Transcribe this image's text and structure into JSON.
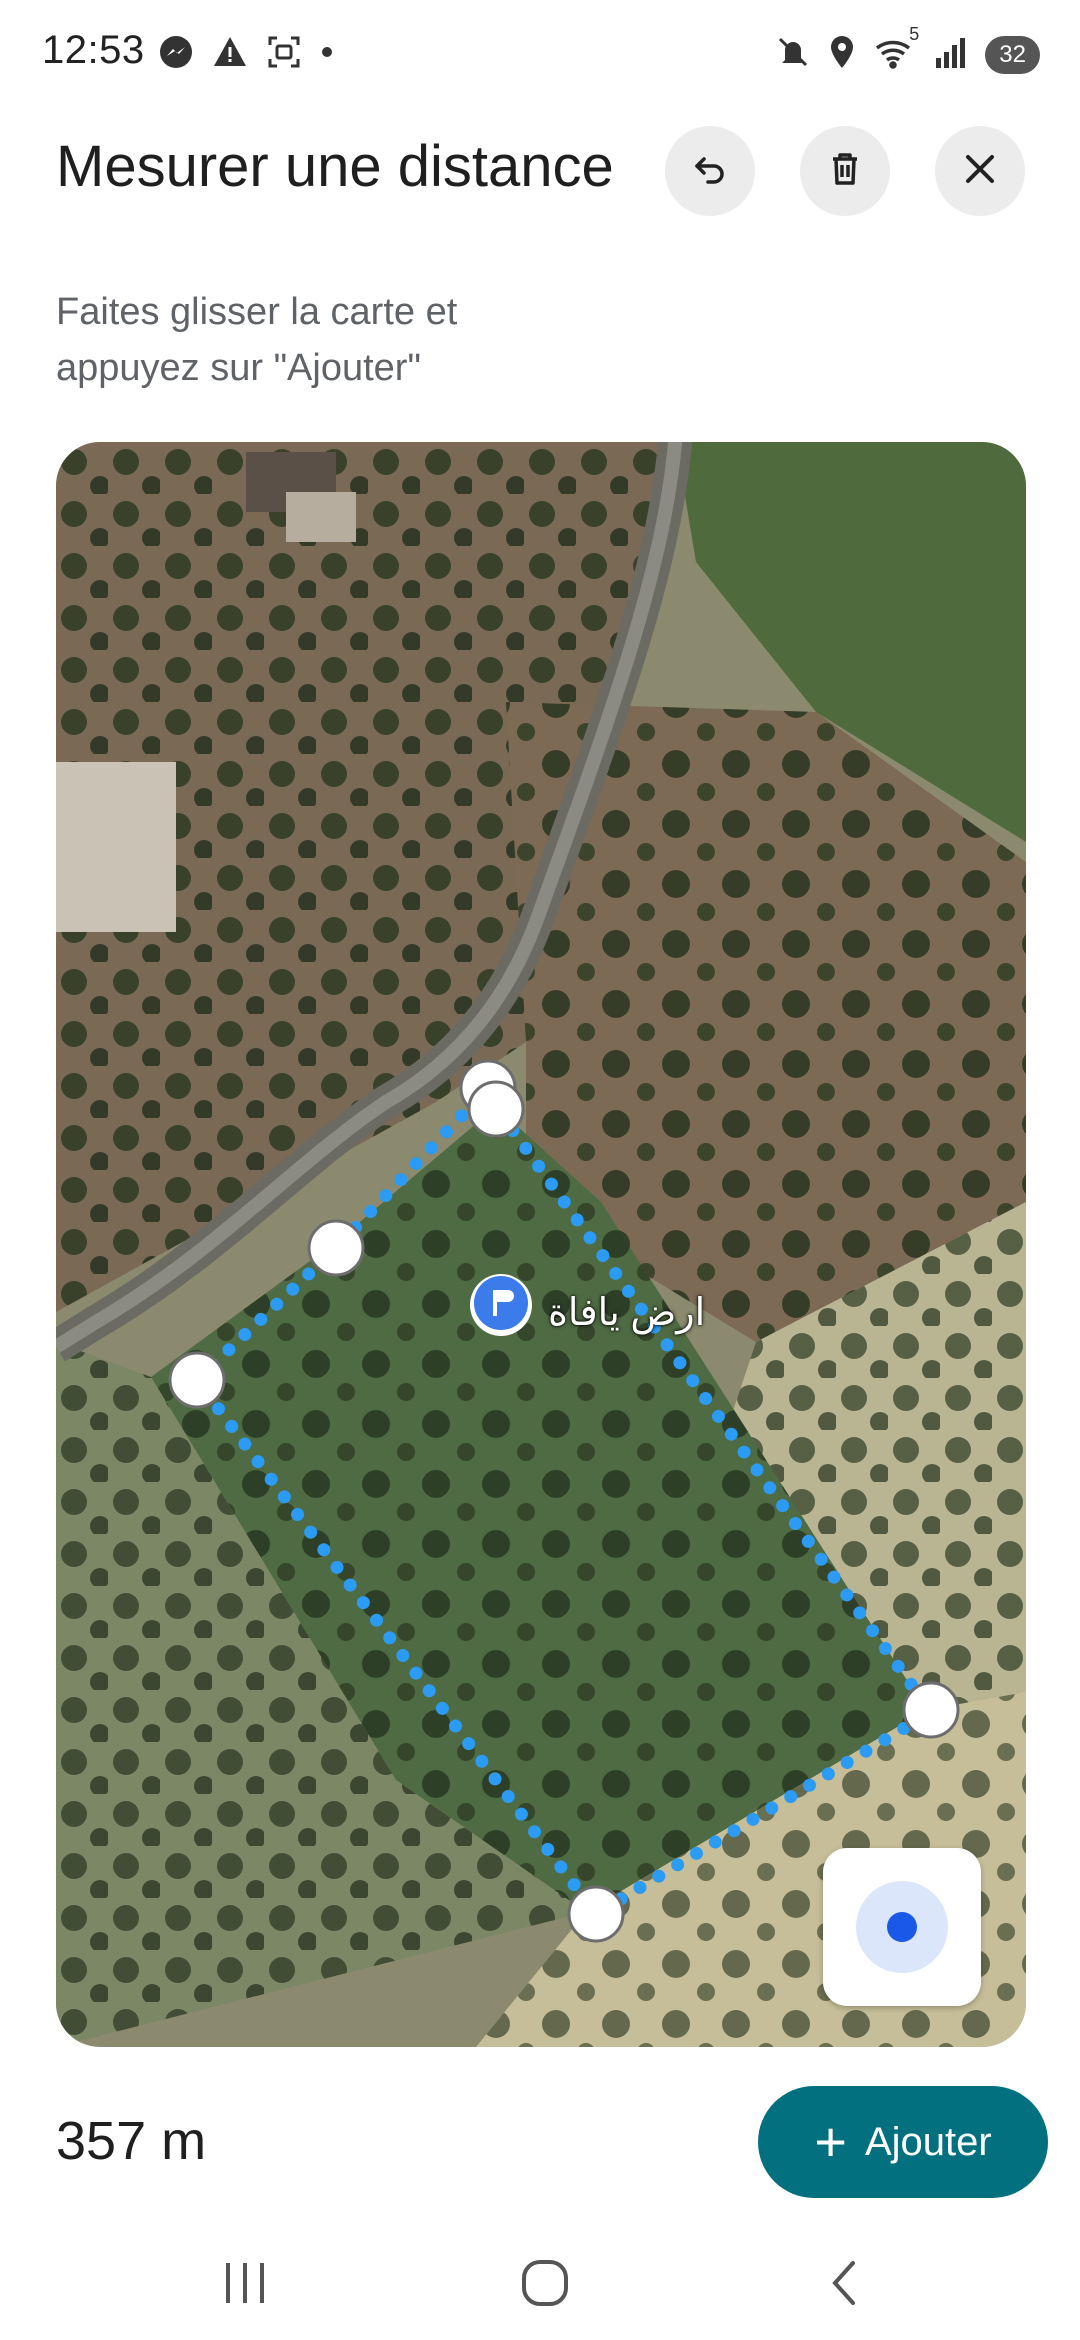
{
  "status_bar": {
    "time": "12:53",
    "left_icons": [
      "messenger-icon",
      "warning-icon",
      "screenshot-icon",
      "dot-icon"
    ],
    "right_icons": [
      "mute-icon",
      "location-icon",
      "wifi-icon",
      "signal-icon"
    ],
    "wifi_badge": "5",
    "battery": "32"
  },
  "header": {
    "title": "Mesurer une distance",
    "subtitle": "Faites glisser la carte et appuyez sur \"Ajouter\"",
    "buttons": [
      "undo-icon",
      "trash-icon",
      "close-icon"
    ]
  },
  "map": {
    "place_label": "ارض يافاة",
    "measure_color": "#2b9bf4",
    "locate_color": "#1a58e8"
  },
  "footer": {
    "distance": "357 m",
    "add_label": "Ajouter",
    "accent": "#02707f"
  },
  "nav": {
    "buttons": [
      "recent-apps-icon",
      "home-icon",
      "back-icon"
    ]
  }
}
